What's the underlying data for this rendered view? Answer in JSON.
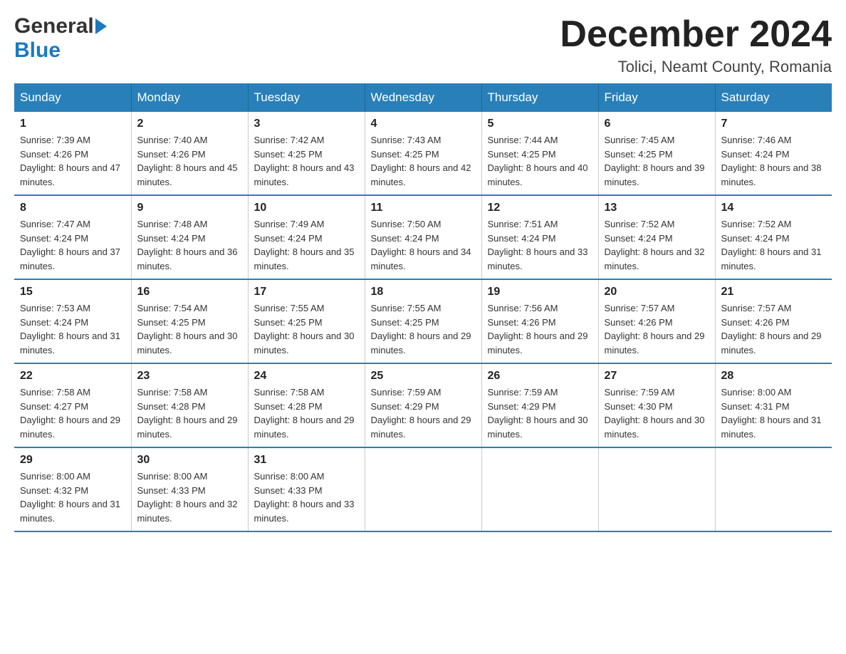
{
  "header": {
    "logo_general": "General",
    "logo_blue": "Blue",
    "month_title": "December 2024",
    "location": "Tolici, Neamt County, Romania"
  },
  "days_of_week": [
    "Sunday",
    "Monday",
    "Tuesday",
    "Wednesday",
    "Thursday",
    "Friday",
    "Saturday"
  ],
  "weeks": [
    [
      {
        "day": "1",
        "sunrise": "7:39 AM",
        "sunset": "4:26 PM",
        "daylight": "8 hours and 47 minutes."
      },
      {
        "day": "2",
        "sunrise": "7:40 AM",
        "sunset": "4:26 PM",
        "daylight": "8 hours and 45 minutes."
      },
      {
        "day": "3",
        "sunrise": "7:42 AM",
        "sunset": "4:25 PM",
        "daylight": "8 hours and 43 minutes."
      },
      {
        "day": "4",
        "sunrise": "7:43 AM",
        "sunset": "4:25 PM",
        "daylight": "8 hours and 42 minutes."
      },
      {
        "day": "5",
        "sunrise": "7:44 AM",
        "sunset": "4:25 PM",
        "daylight": "8 hours and 40 minutes."
      },
      {
        "day": "6",
        "sunrise": "7:45 AM",
        "sunset": "4:25 PM",
        "daylight": "8 hours and 39 minutes."
      },
      {
        "day": "7",
        "sunrise": "7:46 AM",
        "sunset": "4:24 PM",
        "daylight": "8 hours and 38 minutes."
      }
    ],
    [
      {
        "day": "8",
        "sunrise": "7:47 AM",
        "sunset": "4:24 PM",
        "daylight": "8 hours and 37 minutes."
      },
      {
        "day": "9",
        "sunrise": "7:48 AM",
        "sunset": "4:24 PM",
        "daylight": "8 hours and 36 minutes."
      },
      {
        "day": "10",
        "sunrise": "7:49 AM",
        "sunset": "4:24 PM",
        "daylight": "8 hours and 35 minutes."
      },
      {
        "day": "11",
        "sunrise": "7:50 AM",
        "sunset": "4:24 PM",
        "daylight": "8 hours and 34 minutes."
      },
      {
        "day": "12",
        "sunrise": "7:51 AM",
        "sunset": "4:24 PM",
        "daylight": "8 hours and 33 minutes."
      },
      {
        "day": "13",
        "sunrise": "7:52 AM",
        "sunset": "4:24 PM",
        "daylight": "8 hours and 32 minutes."
      },
      {
        "day": "14",
        "sunrise": "7:52 AM",
        "sunset": "4:24 PM",
        "daylight": "8 hours and 31 minutes."
      }
    ],
    [
      {
        "day": "15",
        "sunrise": "7:53 AM",
        "sunset": "4:24 PM",
        "daylight": "8 hours and 31 minutes."
      },
      {
        "day": "16",
        "sunrise": "7:54 AM",
        "sunset": "4:25 PM",
        "daylight": "8 hours and 30 minutes."
      },
      {
        "day": "17",
        "sunrise": "7:55 AM",
        "sunset": "4:25 PM",
        "daylight": "8 hours and 30 minutes."
      },
      {
        "day": "18",
        "sunrise": "7:55 AM",
        "sunset": "4:25 PM",
        "daylight": "8 hours and 29 minutes."
      },
      {
        "day": "19",
        "sunrise": "7:56 AM",
        "sunset": "4:26 PM",
        "daylight": "8 hours and 29 minutes."
      },
      {
        "day": "20",
        "sunrise": "7:57 AM",
        "sunset": "4:26 PM",
        "daylight": "8 hours and 29 minutes."
      },
      {
        "day": "21",
        "sunrise": "7:57 AM",
        "sunset": "4:26 PM",
        "daylight": "8 hours and 29 minutes."
      }
    ],
    [
      {
        "day": "22",
        "sunrise": "7:58 AM",
        "sunset": "4:27 PM",
        "daylight": "8 hours and 29 minutes."
      },
      {
        "day": "23",
        "sunrise": "7:58 AM",
        "sunset": "4:28 PM",
        "daylight": "8 hours and 29 minutes."
      },
      {
        "day": "24",
        "sunrise": "7:58 AM",
        "sunset": "4:28 PM",
        "daylight": "8 hours and 29 minutes."
      },
      {
        "day": "25",
        "sunrise": "7:59 AM",
        "sunset": "4:29 PM",
        "daylight": "8 hours and 29 minutes."
      },
      {
        "day": "26",
        "sunrise": "7:59 AM",
        "sunset": "4:29 PM",
        "daylight": "8 hours and 30 minutes."
      },
      {
        "day": "27",
        "sunrise": "7:59 AM",
        "sunset": "4:30 PM",
        "daylight": "8 hours and 30 minutes."
      },
      {
        "day": "28",
        "sunrise": "8:00 AM",
        "sunset": "4:31 PM",
        "daylight": "8 hours and 31 minutes."
      }
    ],
    [
      {
        "day": "29",
        "sunrise": "8:00 AM",
        "sunset": "4:32 PM",
        "daylight": "8 hours and 31 minutes."
      },
      {
        "day": "30",
        "sunrise": "8:00 AM",
        "sunset": "4:33 PM",
        "daylight": "8 hours and 32 minutes."
      },
      {
        "day": "31",
        "sunrise": "8:00 AM",
        "sunset": "4:33 PM",
        "daylight": "8 hours and 33 minutes."
      },
      null,
      null,
      null,
      null
    ]
  ],
  "labels": {
    "sunrise": "Sunrise:",
    "sunset": "Sunset:",
    "daylight": "Daylight:"
  },
  "colors": {
    "header_bg": "#2980b9",
    "header_text": "#ffffff",
    "border": "#2980b9"
  }
}
